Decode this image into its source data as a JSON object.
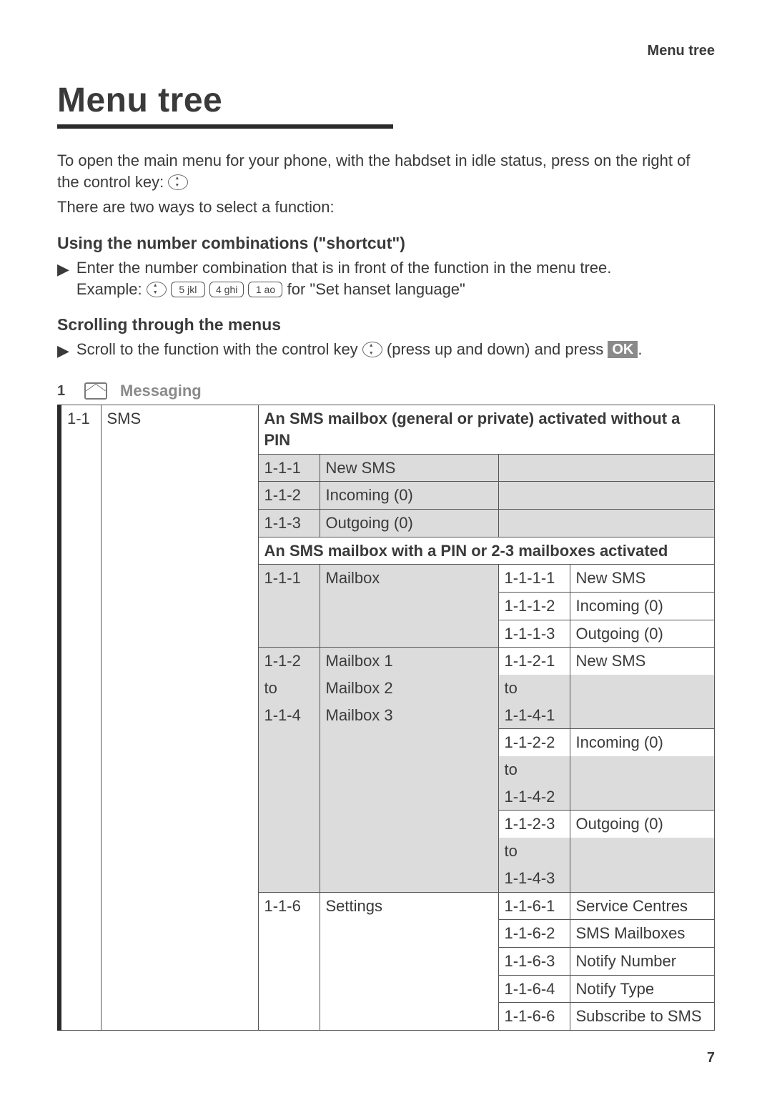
{
  "header": {
    "running": "Menu tree"
  },
  "title": "Menu tree",
  "intro1": "To open the main menu for your phone, with the habdset in idle status, press on the right of the control key: ",
  "intro2": "There are two ways to select a function:",
  "shortcut": {
    "heading": "Using the number combinations (\"shortcut\")",
    "line1": "Enter the number combination that is in front of the function in the menu tree.",
    "example_prefix": "Example: ",
    "keys": [
      "5 jkl",
      "4 ghi",
      "1 ao"
    ],
    "example_suffix": " for \"Set hanset language\""
  },
  "scrolling": {
    "heading": "Scrolling through the menus",
    "line_pre": "Scroll to the function with the control key ",
    "line_mid": " (press up and down) and press ",
    "ok": "OK",
    "line_end": "."
  },
  "section1": {
    "num": "1",
    "label": "Messaging"
  },
  "table": {
    "r1": {
      "idx": "1-1",
      "name": "SMS",
      "head": "An SMS mailbox (general or private) activated without a PIN"
    },
    "r2": {
      "idx": "1-1-1",
      "name": "New SMS"
    },
    "r3": {
      "idx": "1-1-2",
      "name": "Incoming (0)"
    },
    "r4": {
      "idx": "1-1-3",
      "name": "Outgoing (0)"
    },
    "head2": "An SMS mailbox with a PIN or 2-3 mailboxes activated",
    "r5": {
      "idx": "1-1-1",
      "name": "Mailbox",
      "sidx": "1-1-1-1",
      "sname": "New SMS"
    },
    "r6": {
      "sidx": "1-1-1-2",
      "sname": "Incoming (0)"
    },
    "r7": {
      "sidx": "1-1-1-3",
      "sname": "Outgoing (0)"
    },
    "r8": {
      "idx": "1-1-2",
      "name": "Mailbox 1",
      "sidx": "1-1-2-1",
      "sname": "New SMS"
    },
    "r9": {
      "idx": "to",
      "name": "Mailbox 2",
      "sidx": "to"
    },
    "r10": {
      "idx": "1-1-4",
      "name": "Mailbox 3",
      "sidx": "1-1-4-1"
    },
    "r11": {
      "sidx": "1-1-2-2",
      "sname": "Incoming (0)"
    },
    "r12": {
      "sidx": "to"
    },
    "r13": {
      "sidx": "1-1-4-2"
    },
    "r14": {
      "sidx": "1-1-2-3",
      "sname": "Outgoing (0)"
    },
    "r15": {
      "sidx": "to"
    },
    "r16": {
      "sidx": "1-1-4-3"
    },
    "r17": {
      "idx": "1-1-6",
      "name": "Settings",
      "sidx": "1-1-6-1",
      "sname": "Service Centres"
    },
    "r18": {
      "sidx": "1-1-6-2",
      "sname": "SMS Mailboxes"
    },
    "r19": {
      "sidx": "1-1-6-3",
      "sname": "Notify Number"
    },
    "r20": {
      "sidx": "1-1-6-4",
      "sname": "Notify Type"
    },
    "r21": {
      "sidx": "1-1-6-6",
      "sname": "Subscribe to SMS"
    }
  },
  "page_number": "7"
}
